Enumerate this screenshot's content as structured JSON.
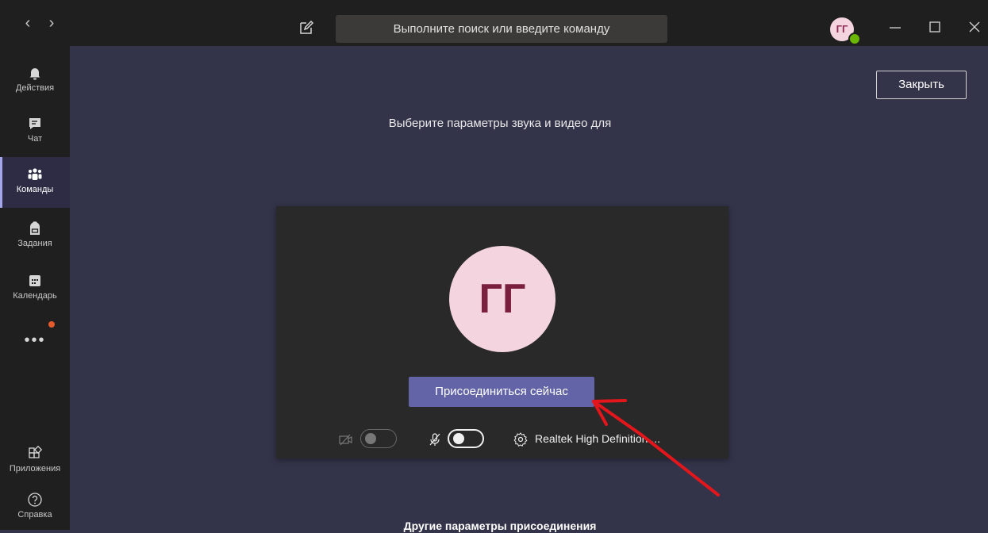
{
  "titlebar": {
    "search_placeholder": "Выполните поиск или введите команду",
    "user_initials": "ГГ"
  },
  "rail": {
    "items": [
      {
        "label": "Действия",
        "icon": "bell-icon"
      },
      {
        "label": "Чат",
        "icon": "chat-icon"
      },
      {
        "label": "Команды",
        "icon": "teams-icon",
        "active": true
      },
      {
        "label": "Задания",
        "icon": "backpack-icon"
      },
      {
        "label": "Календарь",
        "icon": "calendar-icon"
      }
    ],
    "more": "•••",
    "bottom": [
      {
        "label": "Приложения",
        "icon": "apps-icon"
      },
      {
        "label": "Справка",
        "icon": "help-icon"
      }
    ]
  },
  "main": {
    "close_label": "Закрыть",
    "headline": "Выберите параметры звука и видео для",
    "preview": {
      "initials": "ГГ",
      "join_label": "Присоединиться сейчас",
      "video_toggle": "off",
      "mic_toggle": "off",
      "device_label": "Realtek High Definition ..."
    },
    "other_options": "Другие параметры присоединения"
  },
  "colors": {
    "accent": "#6264a7",
    "background": "#33344a",
    "rail": "#1f1f1f",
    "annotation_arrow": "#e3161c"
  }
}
